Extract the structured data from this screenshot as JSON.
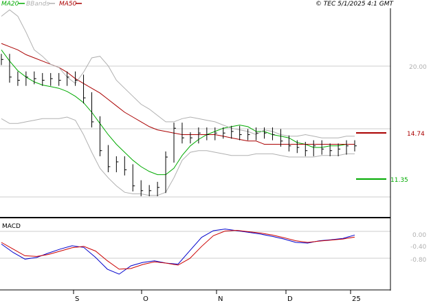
{
  "header": {
    "legend": [
      {
        "label": "MA20",
        "color": "#00aa00"
      },
      {
        "label": "BBands",
        "color": "#b0b0b0"
      },
      {
        "label": "MA50",
        "color": "#aa0000"
      }
    ],
    "copyright": "© TEC 5/1/2025 4:1 GMT"
  },
  "macd_label": "MACD",
  "chart_data": [
    {
      "type": "ohlc",
      "y_ticks": [
        "20.00"
      ],
      "ylim": [
        8.5,
        21.5
      ],
      "x_ticks": [
        "S",
        "O",
        "N",
        "D",
        "25"
      ],
      "grid": true,
      "markers": [
        {
          "label": "14.74",
          "value": 14.74,
          "color": "#aa0000"
        },
        {
          "label": "11.35",
          "value": 11.35,
          "color": "#00aa00"
        }
      ],
      "series": [
        {
          "name": "MA20",
          "color": "#00aa00",
          "values": [
            18.9,
            18.2,
            17.6,
            17.2,
            16.9,
            16.7,
            16.6,
            16.5,
            16.3,
            16.0,
            15.6,
            15.0,
            14.3,
            13.6,
            13.0,
            12.5,
            12.0,
            11.6,
            11.3,
            11.1,
            11.1,
            11.5,
            12.3,
            12.9,
            13.3,
            13.6,
            13.8,
            14.0,
            14.1,
            14.2,
            14.1,
            13.8,
            13.8,
            13.6,
            13.5,
            13.4,
            13.1,
            13.0,
            12.8,
            12.8,
            12.9,
            12.9,
            13.0,
            13.0
          ]
        },
        {
          "name": "MA50",
          "color": "#aa0000",
          "values": [
            19.3,
            19.1,
            18.9,
            18.6,
            18.4,
            18.2,
            18.0,
            17.8,
            17.5,
            17.1,
            16.8,
            16.5,
            16.2,
            15.8,
            15.4,
            15.0,
            14.7,
            14.4,
            14.1,
            13.9,
            13.8,
            13.7,
            13.6,
            13.6,
            13.6,
            13.6,
            13.6,
            13.5,
            13.4,
            13.3,
            13.2,
            13.2,
            13.0,
            13.0,
            13.0,
            13.0,
            13.0,
            13.0,
            13.0,
            13.0,
            13.0,
            13.0,
            13.0,
            13.0
          ]
        },
        {
          "name": "BBands upper",
          "color": "#b0b0b0",
          "values": [
            21.0,
            21.4,
            21.0,
            20.0,
            18.9,
            18.5,
            18.0,
            17.8,
            17.2,
            16.8,
            17.5,
            18.4,
            18.5,
            17.9,
            17.0,
            16.5,
            16.0,
            15.5,
            15.2,
            14.8,
            14.4,
            14.4,
            14.6,
            14.7,
            14.6,
            14.5,
            14.4,
            14.2,
            14.0,
            13.9,
            13.8,
            13.6,
            13.9,
            13.8,
            13.6,
            13.5,
            13.5,
            13.6,
            13.5,
            13.4,
            13.4,
            13.4,
            13.5,
            13.5
          ]
        },
        {
          "name": "BBands lower",
          "color": "#b0b0b0",
          "values": [
            14.6,
            14.3,
            14.3,
            14.4,
            14.5,
            14.6,
            14.6,
            14.6,
            14.7,
            14.5,
            13.6,
            12.5,
            11.5,
            10.9,
            10.4,
            10.0,
            9.9,
            9.9,
            9.8,
            9.8,
            10.0,
            10.9,
            12.0,
            12.5,
            12.6,
            12.6,
            12.5,
            12.4,
            12.3,
            12.3,
            12.3,
            12.4,
            12.4,
            12.4,
            12.3,
            12.2,
            12.2,
            12.2,
            12.2,
            12.3,
            12.3,
            12.3,
            12.4,
            12.4
          ]
        },
        {
          "name": "Price",
          "color": "#000000",
          "values": [
            18.3,
            17.2,
            17.0,
            17.2,
            17.1,
            17.0,
            17.1,
            17.0,
            17.2,
            17.0,
            15.9,
            14.4,
            12.6,
            11.6,
            11.9,
            11.4,
            10.4,
            10.1,
            10.1,
            10.3,
            12.2,
            14.0,
            13.4,
            13.4,
            13.7,
            13.6,
            13.7,
            13.7,
            13.8,
            13.6,
            13.6,
            13.7,
            13.7,
            13.6,
            13.2,
            12.9,
            12.8,
            12.6,
            12.9,
            12.7,
            12.6,
            12.7,
            12.9,
            12.9
          ]
        }
      ]
    },
    {
      "type": "line",
      "title": "MACD",
      "y_ticks": [
        "0.00",
        "-0.40",
        "-0.80"
      ],
      "ylim": [
        -1.5,
        0.6
      ],
      "grid": true,
      "series": [
        {
          "name": "MACD",
          "color": "#0000cc",
          "values": [
            -0.15,
            -0.4,
            -0.6,
            -0.55,
            -0.42,
            -0.3,
            -0.2,
            -0.25,
            -0.55,
            -0.9,
            -1.05,
            -0.8,
            -0.7,
            -0.65,
            -0.72,
            -0.75,
            -0.35,
            0.05,
            0.25,
            0.3,
            0.25,
            0.2,
            0.15,
            0.08,
            0.0,
            -0.1,
            -0.12,
            -0.05,
            -0.02,
            0.02,
            0.12
          ]
        },
        {
          "name": "Signal",
          "color": "#cc0000",
          "values": [
            -0.1,
            -0.3,
            -0.5,
            -0.52,
            -0.46,
            -0.36,
            -0.26,
            -0.22,
            -0.36,
            -0.65,
            -0.9,
            -0.88,
            -0.76,
            -0.68,
            -0.72,
            -0.78,
            -0.58,
            -0.22,
            0.1,
            0.24,
            0.26,
            0.22,
            0.18,
            0.12,
            0.04,
            -0.05,
            -0.1,
            -0.06,
            -0.03,
            0.0,
            0.06
          ]
        }
      ]
    }
  ]
}
